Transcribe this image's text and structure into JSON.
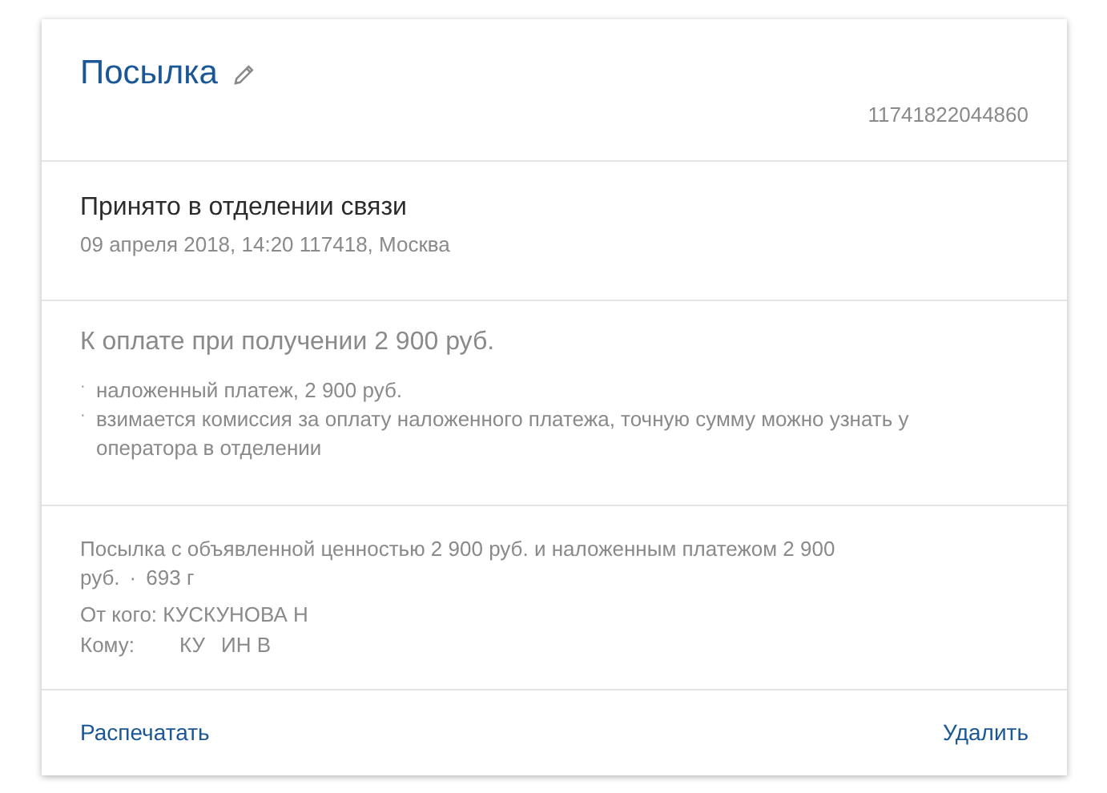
{
  "header": {
    "title": "Посылка",
    "tracking_number": "11741822044860"
  },
  "status": {
    "title": "Принято в отделении связи",
    "details": "09 апреля 2018, 14:20 117418, Москва"
  },
  "payment": {
    "title": "К оплате при получении 2 900 руб.",
    "notes": [
      {
        "bullet": "·",
        "text": "наложенный платеж, 2 900 руб."
      },
      {
        "bullet": "·",
        "text": "взимается комиссия за оплату наложенного платежа, точную сумму можно узнать у оператора в отделении"
      }
    ]
  },
  "details": {
    "description": "Посылка с объявленной ценностью 2 900 руб. и наложенным платежом 2 900 руб.",
    "separator": "·",
    "weight": "693 г",
    "sender": "От кого: КУСКУНОВА Н",
    "recipient_label": "Кому:",
    "recipient_visible": [
      "КУ",
      "ИН В"
    ]
  },
  "actions": [
    {
      "label": "Распечатать"
    },
    {
      "label": "Удалить"
    }
  ]
}
